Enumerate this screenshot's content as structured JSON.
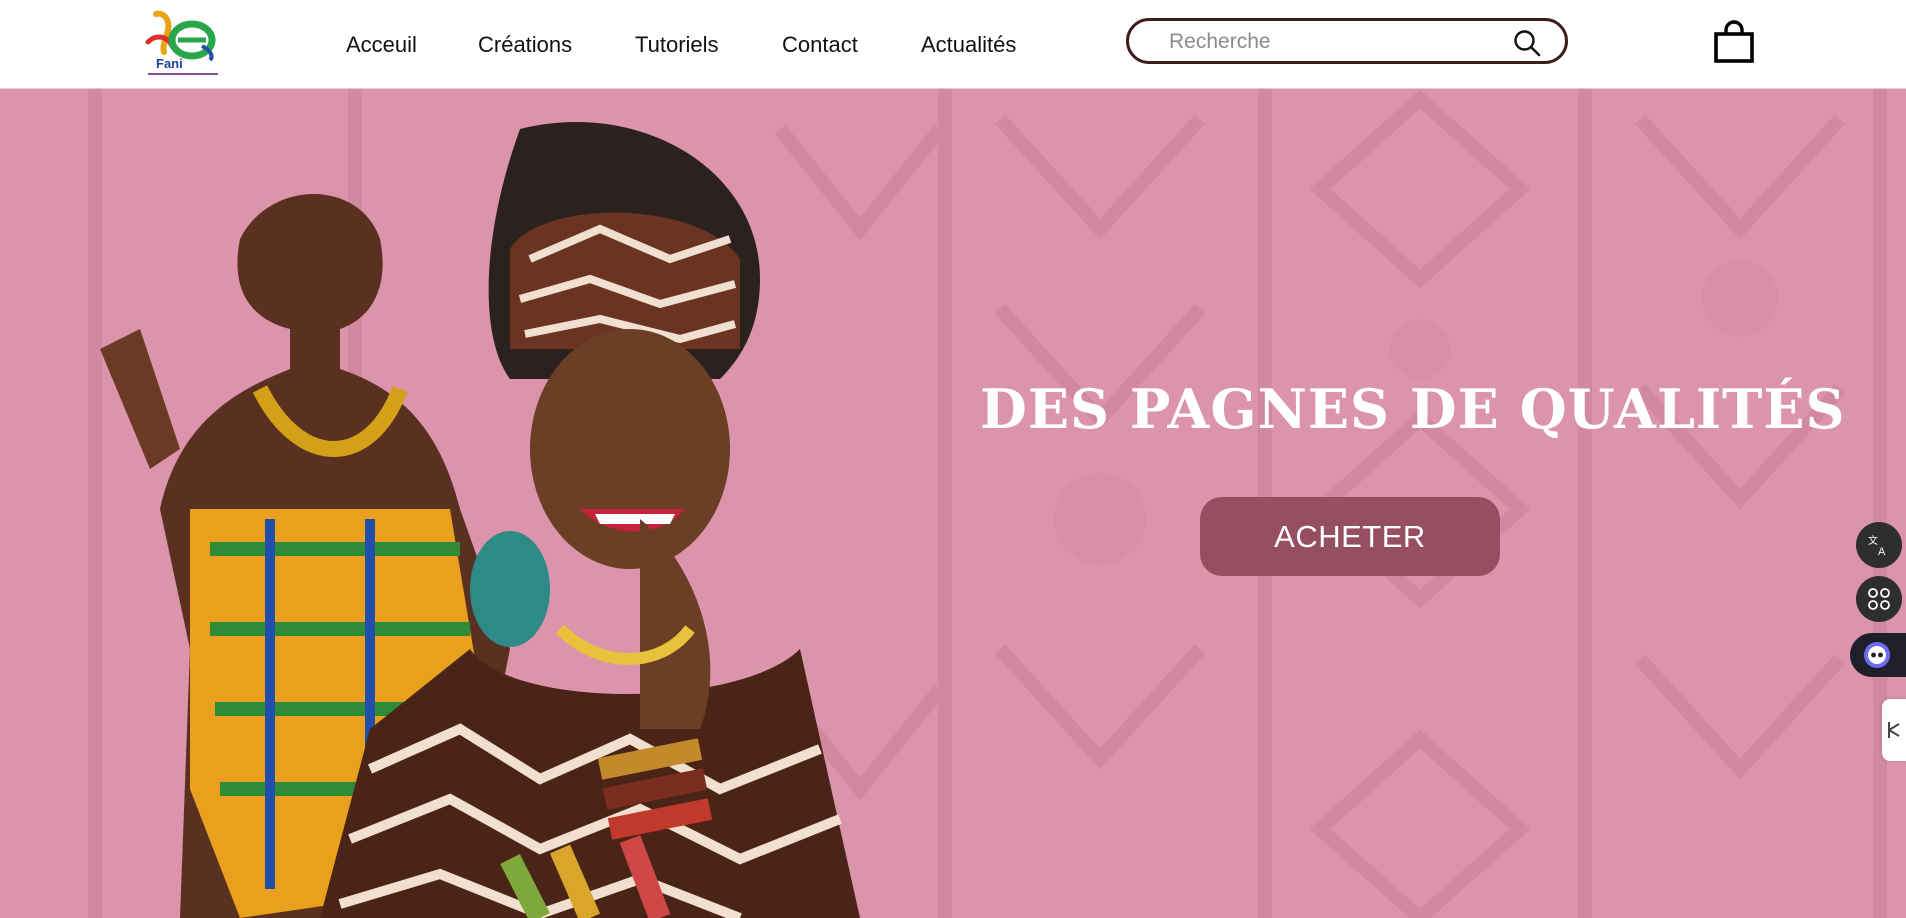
{
  "header": {
    "logo_text": "Fani",
    "nav": [
      "Acceuil",
      "Créations",
      "Tutoriels",
      "Contact",
      "Actualités"
    ],
    "search": {
      "placeholder": "Recherche",
      "value": ""
    },
    "icons": {
      "search": "search-icon",
      "cart": "shopping-bag-icon"
    }
  },
  "hero": {
    "title": "DES PAGNES DE QUALITÉS",
    "cta_label": "ACHETER"
  },
  "side_widgets": [
    "translate-icon",
    "apps-grid-icon",
    "ai-assistant-icon",
    "sidebar-toggle-icon"
  ],
  "colors": {
    "hero_background": "#db94ab",
    "cta_background": "#964f62",
    "search_border": "#3e1c19",
    "nav_text": "#111111"
  }
}
